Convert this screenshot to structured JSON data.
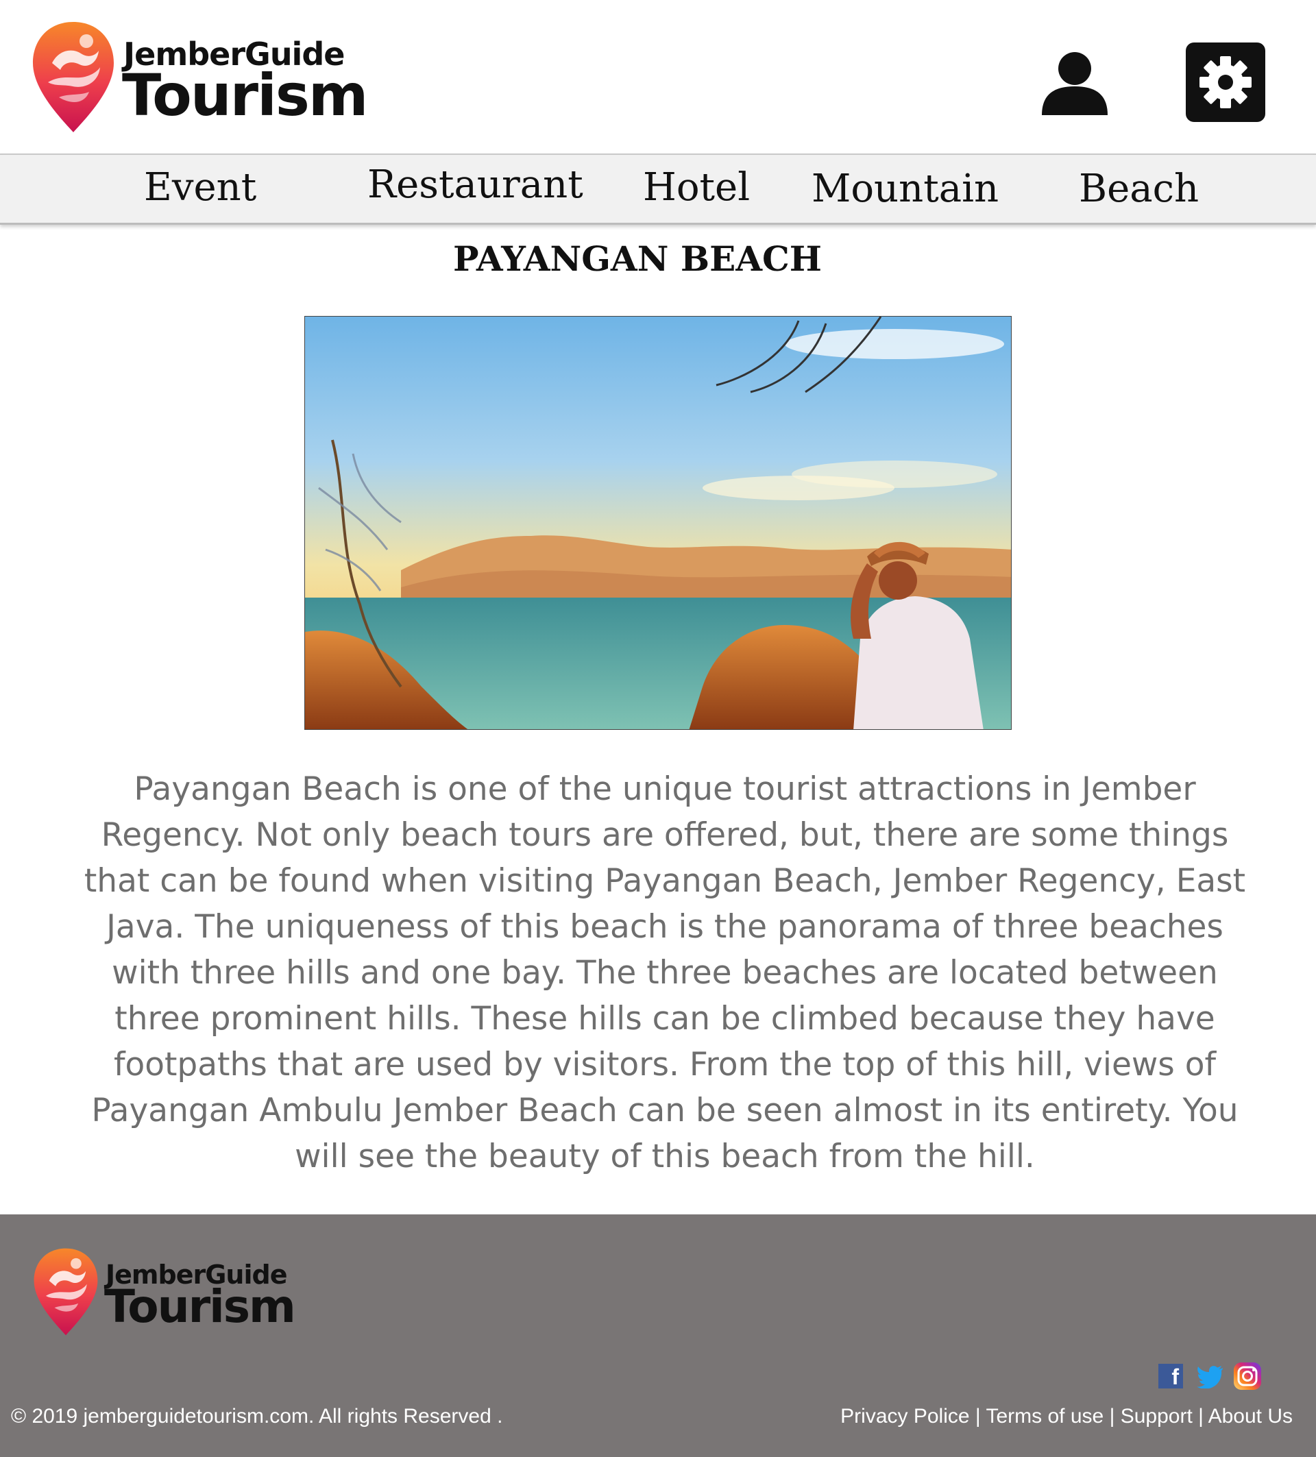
{
  "brand": {
    "line1": "JemberGuide",
    "line2": "Tourism"
  },
  "header": {
    "user_icon": "user-icon",
    "settings_icon": "gear-icon"
  },
  "nav": {
    "items": [
      {
        "label": "Event"
      },
      {
        "label": "Restaurant"
      },
      {
        "label": "Hotel"
      },
      {
        "label": "Mountain"
      },
      {
        "label": "Beach"
      }
    ]
  },
  "page": {
    "title": "PAYANGAN BEACH",
    "description": "Payangan Beach is one of the unique tourist attractions in Jember Regency. Not only beach tours are offered, but, there are some things that can be found when visiting Payangan Beach, Jember Regency, East Java. The uniqueness of this beach is the panorama of three beaches with three hills and one bay. The three beaches are located between three prominent hills. These hills can be climbed because they have footpaths that are used by visitors. From the top of this hill, views of Payangan Ambulu Jember Beach can be seen almost in its entirety. You will see the beauty of this beach from the hill."
  },
  "footer": {
    "copyright": "© 2019 jemberguidetourism.com. All rights Reserved .",
    "links": [
      {
        "label": "Privacy Police"
      },
      {
        "label": "Terms of use"
      },
      {
        "label": "Support"
      },
      {
        "label": "About Us"
      }
    ],
    "separator": " | ",
    "social": [
      "facebook-icon",
      "twitter-icon",
      "instagram-icon"
    ]
  },
  "colors": {
    "footer_bg": "#797575",
    "nav_bg": "#f1f1f1",
    "text_gray": "#6e6e6e",
    "logo_gradient_top": "#f57a2a",
    "logo_gradient_bottom": "#d8174f"
  }
}
